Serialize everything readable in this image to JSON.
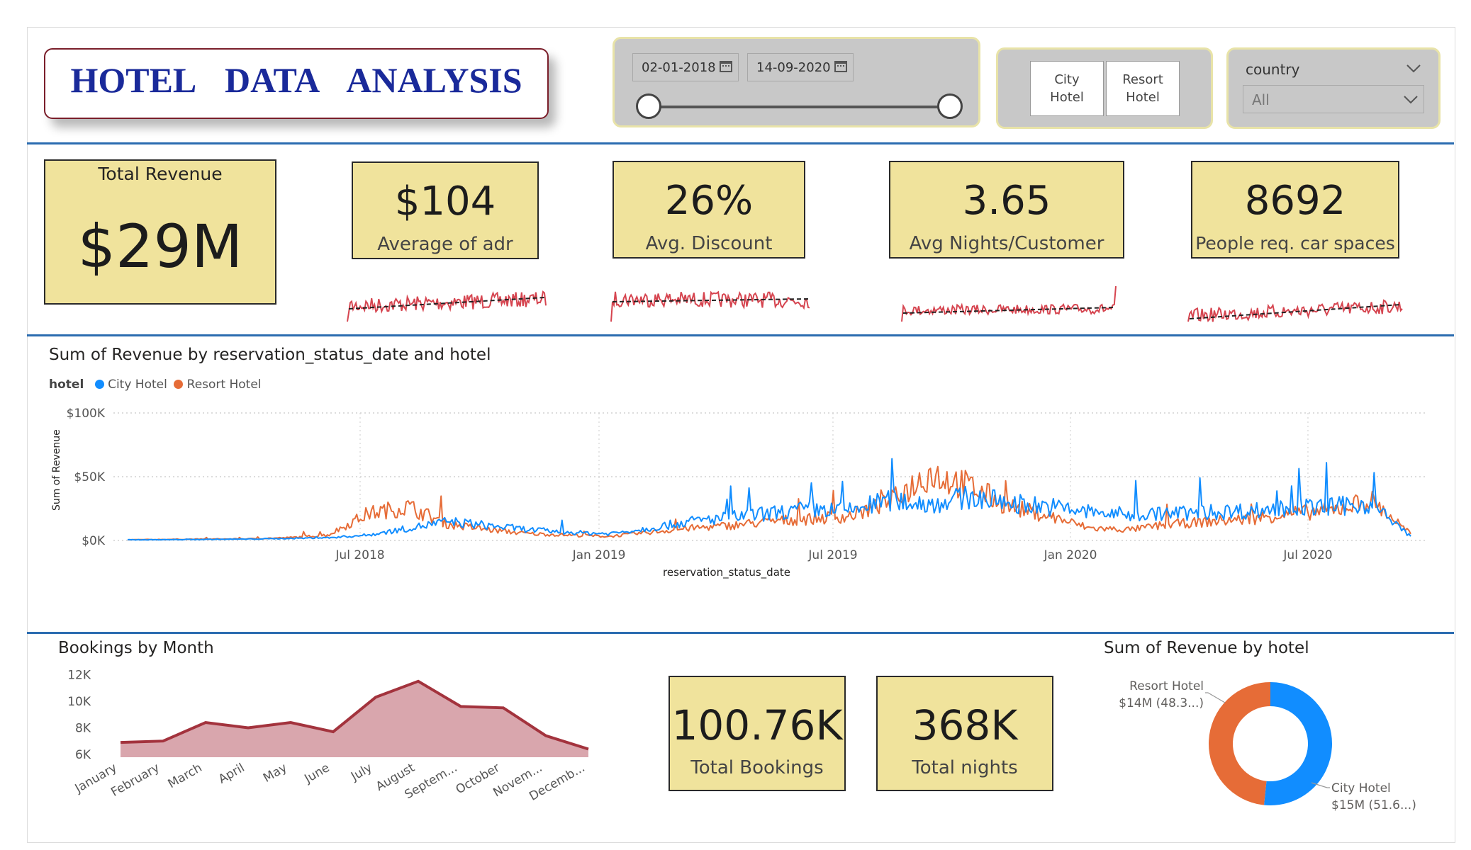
{
  "header": {
    "title": "HOTEL    DATA    ANALYSIS"
  },
  "date_filter": {
    "start": "02-01-2018",
    "end": "14-09-2020",
    "range_start_fraction": 0.0,
    "range_end_fraction": 1.0
  },
  "hotel_slicer": {
    "options": [
      "City\nHotel",
      "Resort\nHotel"
    ]
  },
  "country_slicer": {
    "label": "country",
    "selected": "All"
  },
  "kpis": {
    "total_revenue": {
      "label": "Total Revenue",
      "value": "$29M"
    },
    "adr": {
      "value": "$104",
      "label": "Average of adr"
    },
    "discount": {
      "value": "26%",
      "label": "Avg. Discount"
    },
    "nights": {
      "value": "3.65",
      "label": "Avg Nights/Customer"
    },
    "parking": {
      "value": "8692",
      "label": "People req. car spaces"
    },
    "bookings": {
      "value": "100.76K",
      "label": "Total Bookings"
    },
    "total_nights": {
      "value": "368K",
      "label": "Total nights"
    }
  },
  "colors": {
    "city": "#118dff",
    "resort": "#e66c37",
    "spark": "#d64550",
    "area_line": "#a3333d",
    "area_fill": "#d9a6ad",
    "kpi_bg": "#f0e39c",
    "rule": "#2b6cb0"
  },
  "chart_data": [
    {
      "type": "line",
      "title": "Sum of Revenue by reservation_status_date and hotel",
      "legend_title": "hotel",
      "legend_position": "top-left",
      "xlabel": "reservation_status_date",
      "ylabel": "Sum of Revenue",
      "x_ticks": [
        "Jul 2018",
        "Jan 2019",
        "Jul 2019",
        "Jan 2020",
        "Jul 2020"
      ],
      "y_ticks": [
        "$0K",
        "$50K",
        "$100K"
      ],
      "ylim": [
        0,
        100000
      ],
      "grid": true,
      "x": [
        "2017-10",
        "2017-12",
        "2018-02",
        "2018-04",
        "2018-05",
        "2018-06",
        "2018-07",
        "2018-08",
        "2018-09",
        "2018-10",
        "2018-11",
        "2018-12",
        "2019-01",
        "2019-02",
        "2019-03",
        "2019-04",
        "2019-05",
        "2019-06",
        "2019-07",
        "2019-08",
        "2019-09",
        "2019-10",
        "2019-11",
        "2019-12",
        "2020-01",
        "2020-02",
        "2020-03",
        "2020-04",
        "2020-05",
        "2020-06",
        "2020-07",
        "2020-08",
        "2020-09"
      ],
      "series": [
        {
          "name": "City Hotel",
          "values": [
            500,
            600,
            800,
            1000,
            1500,
            2000,
            4000,
            9000,
            14000,
            11000,
            8000,
            6000,
            5000,
            9000,
            14000,
            17000,
            20000,
            23000,
            22000,
            30000,
            27000,
            32000,
            28000,
            25000,
            21000,
            19000,
            20000,
            21000,
            22000,
            24000,
            25000,
            27000,
            3000
          ]
        },
        {
          "name": "Resort Hotel",
          "values": [
            500,
            800,
            1000,
            1200,
            2000,
            4000,
            20000,
            25000,
            12000,
            8000,
            5000,
            4000,
            3000,
            6000,
            9000,
            11000,
            14000,
            16000,
            18000,
            28000,
            50000,
            40000,
            25000,
            18000,
            9000,
            8000,
            12000,
            14000,
            16000,
            20000,
            22000,
            30000,
            5000
          ]
        }
      ]
    },
    {
      "type": "area",
      "title": "Bookings by Month",
      "categories": [
        "January",
        "February",
        "March",
        "April",
        "May",
        "June",
        "July",
        "August",
        "Septem...",
        "October",
        "Novem...",
        "Decemb..."
      ],
      "values": [
        6900,
        7000,
        8400,
        8000,
        8400,
        7700,
        10300,
        11500,
        9600,
        9500,
        7400,
        6400
      ],
      "y_ticks": [
        "6K",
        "8K",
        "10K",
        "12K"
      ],
      "ylim": [
        6000,
        12500
      ]
    },
    {
      "type": "pie",
      "title": "Sum of Revenue by hotel",
      "slices": [
        {
          "name": "City Hotel",
          "value_label": "$15M (51.6...)",
          "share": 51.6
        },
        {
          "name": "Resort Hotel",
          "value_label": "$14M (48.3...)",
          "share": 48.3
        }
      ]
    }
  ]
}
